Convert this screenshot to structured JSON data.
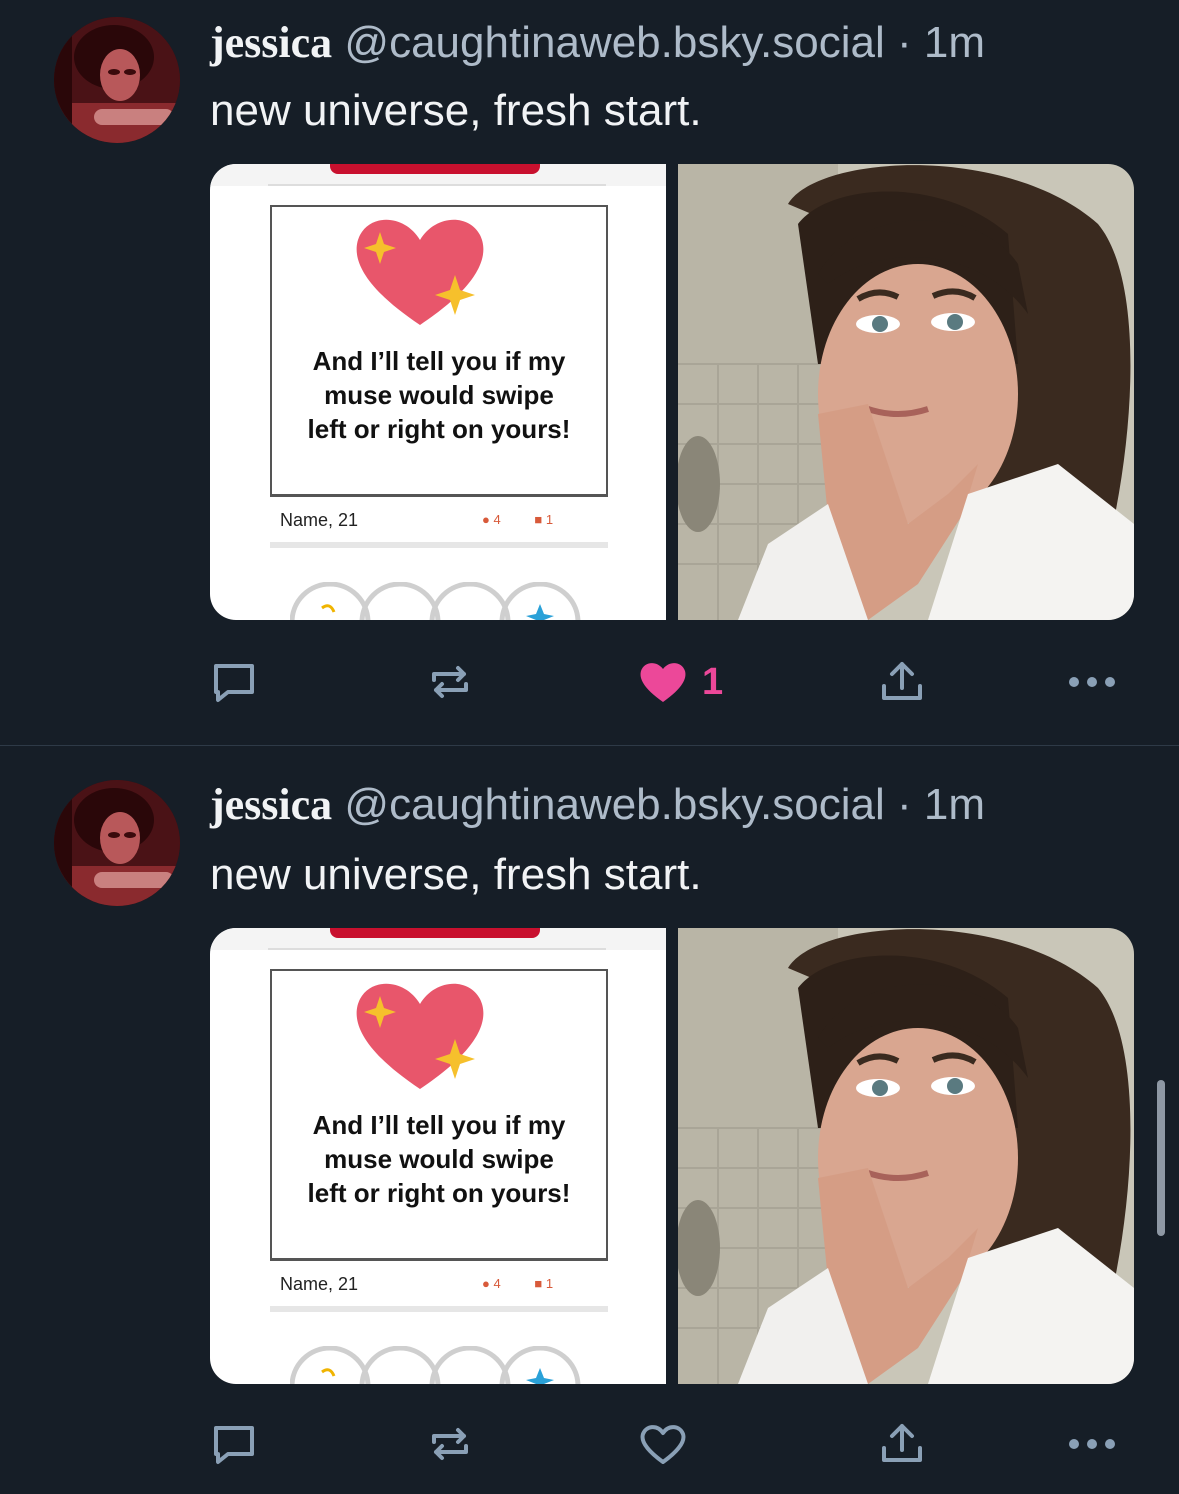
{
  "posts": [
    {
      "author": {
        "name": "jessica",
        "handle": "@caughtinaweb.bsky.social",
        "separator": "·",
        "time": "1m"
      },
      "text": "new universe, fresh start.",
      "card": {
        "text_line1": "And I’ll tell you if my",
        "text_line2": "muse would swipe",
        "text_line3": "left or right on yours!",
        "name_age": "Name, 21",
        "stat1": "4",
        "stat2": "1"
      },
      "actions": {
        "liked": true,
        "like_count": "1"
      }
    },
    {
      "author": {
        "name": "jessica",
        "handle": "@caughtinaweb.bsky.social",
        "separator": "·",
        "time": "1m"
      },
      "text": "new universe, fresh start.",
      "card": {
        "text_line1": "And I’ll tell you if my",
        "text_line2": "muse would swipe",
        "text_line3": "left or right on yours!",
        "name_age": "Name, 21",
        "stat1": "4",
        "stat2": "1"
      },
      "actions": {
        "liked": false,
        "like_count": ""
      }
    }
  ],
  "icons": {
    "reply": "reply-icon",
    "repost": "repost-icon",
    "like": "heart-icon",
    "share": "share-icon",
    "more": "more-icon"
  },
  "colors": {
    "background": "#161e27",
    "icon": "#8aa0b6",
    "like_active": "#ec4899"
  }
}
